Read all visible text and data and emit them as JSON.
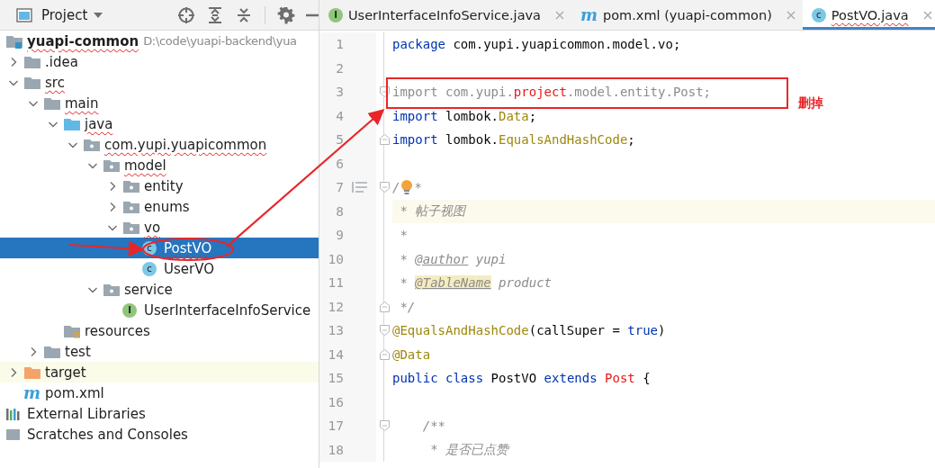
{
  "project_panel": {
    "title": "Project"
  },
  "tree": [
    {
      "label": "yuapi-common",
      "path": "D:\\code\\yuapi-backend\\yua",
      "kind": "module",
      "misspelled": true,
      "selected": false,
      "children": [
        {
          "label": ".idea",
          "kind": "folder",
          "expanded": false,
          "selected": false
        },
        {
          "label": "src",
          "kind": "folder",
          "expanded": true,
          "misspelled": true,
          "selected": false,
          "children": [
            {
              "label": "main",
              "kind": "folder",
              "expanded": true,
              "misspelled": true,
              "selected": false,
              "children": [
                {
                  "label": "java",
                  "kind": "source",
                  "expanded": true,
                  "misspelled": true,
                  "selected": false,
                  "children": [
                    {
                      "label": "com.yupi.yuapicommon",
                      "kind": "package",
                      "expanded": true,
                      "misspelled": true,
                      "selected": false,
                      "children": [
                        {
                          "label": "model",
                          "kind": "package",
                          "expanded": true,
                          "misspelled": true,
                          "selected": false,
                          "children": [
                            {
                              "label": "entity",
                              "kind": "package",
                              "expanded": false,
                              "selected": false
                            },
                            {
                              "label": "enums",
                              "kind": "package",
                              "expanded": false,
                              "selected": false
                            },
                            {
                              "label": "vo",
                              "kind": "package",
                              "expanded": true,
                              "misspelled": true,
                              "selected": false,
                              "children": [
                                {
                                  "label": "PostVO",
                                  "kind": "class",
                                  "glyph": "c",
                                  "misspelled": true,
                                  "selected": true
                                },
                                {
                                  "label": "UserVO",
                                  "kind": "class",
                                  "glyph": "c",
                                  "selected": false
                                }
                              ]
                            }
                          ]
                        },
                        {
                          "label": "service",
                          "kind": "package",
                          "expanded": true,
                          "selected": false,
                          "children": [
                            {
                              "label": "UserInterfaceInfoService",
                              "kind": "interface",
                              "glyph": "I",
                              "selected": false
                            }
                          ]
                        }
                      ]
                    }
                  ]
                },
                {
                  "label": "resources",
                  "kind": "resources",
                  "selected": false
                }
              ]
            },
            {
              "label": "test",
              "kind": "folder",
              "expanded": false,
              "selected": false
            }
          ]
        },
        {
          "label": "target",
          "kind": "excluded",
          "expanded": false,
          "highlighted": true,
          "selected": false
        },
        {
          "label": "pom.xml",
          "kind": "maven",
          "glyph": "m",
          "selected": false
        }
      ]
    },
    {
      "label": "External Libraries",
      "kind": "libraries",
      "selected": false
    },
    {
      "label": "Scratches and Consoles",
      "kind": "scratches",
      "selected": false
    }
  ],
  "tabs": [
    {
      "label": "UserInterfaceInfoService.java",
      "kind": "interface",
      "glyph": "I",
      "selected": false
    },
    {
      "label": "pom.xml (yuapi-common)",
      "kind": "maven",
      "glyph": "m",
      "selected": false
    },
    {
      "label": "PostVO.java",
      "kind": "class",
      "glyph": "c",
      "selected": true,
      "misspelled": true
    }
  ],
  "code_lines": [
    {
      "number": "1",
      "tokens": [
        {
          "kind": "keyword",
          "text": "package"
        },
        {
          "kind": "plain",
          "text": " com.yupi.yuapicommon.model.vo;"
        }
      ]
    },
    {
      "number": "2"
    },
    {
      "number": "3",
      "fold_start": true,
      "tokens": [
        {
          "kind": "unused",
          "text": "import com.yupi."
        },
        {
          "kind": "error",
          "text": "project"
        },
        {
          "kind": "unused",
          "text": ".model.entity.Post;"
        }
      ]
    },
    {
      "number": "4",
      "tokens": [
        {
          "kind": "keyword",
          "text": "import"
        },
        {
          "kind": "plain",
          "text": " lombok."
        },
        {
          "kind": "annotation",
          "text": "Data"
        },
        {
          "kind": "plain",
          "text": ";"
        }
      ]
    },
    {
      "number": "5",
      "fold_end": true,
      "tokens": [
        {
          "kind": "keyword",
          "text": "import"
        },
        {
          "kind": "plain",
          "text": " lombok."
        },
        {
          "kind": "annotation",
          "text": "EqualsAndHashCode"
        },
        {
          "kind": "plain",
          "text": ";"
        }
      ]
    },
    {
      "number": "6"
    },
    {
      "number": "7",
      "fold_start": true,
      "doc_toggle": true,
      "tokens": [
        {
          "kind": "comment",
          "text": "/"
        },
        {
          "kind": "bulb"
        },
        {
          "kind": "comment",
          "text": "*"
        }
      ]
    },
    {
      "number": "8",
      "current": true,
      "tokens": [
        {
          "kind": "comment",
          "text": " * 帖子视图"
        }
      ]
    },
    {
      "number": "9",
      "tokens": [
        {
          "kind": "comment",
          "text": " *"
        }
      ]
    },
    {
      "number": "10",
      "tokens": [
        {
          "kind": "comment",
          "text": " * "
        },
        {
          "kind": "doc-tag",
          "text": "@author"
        },
        {
          "kind": "comment",
          "text": " yupi"
        }
      ]
    },
    {
      "number": "11",
      "tokens": [
        {
          "kind": "comment",
          "text": " * "
        },
        {
          "kind": "doc-tag-marked",
          "text": "@TableName"
        },
        {
          "kind": "comment",
          "text": " product"
        }
      ]
    },
    {
      "number": "12",
      "fold_end": true,
      "tokens": [
        {
          "kind": "comment",
          "text": " */"
        }
      ]
    },
    {
      "number": "13",
      "fold_start": true,
      "tokens": [
        {
          "kind": "annotation",
          "text": "@EqualsAndHashCode"
        },
        {
          "kind": "plain",
          "text": "(callSuper = "
        },
        {
          "kind": "keyword",
          "text": "true"
        },
        {
          "kind": "plain",
          "text": ")"
        }
      ]
    },
    {
      "number": "14",
      "fold_end": true,
      "tokens": [
        {
          "kind": "annotation",
          "text": "@Data"
        }
      ]
    },
    {
      "number": "15",
      "tokens": [
        {
          "kind": "keyword",
          "text": "public class"
        },
        {
          "kind": "plain",
          "text": " PostVO "
        },
        {
          "kind": "keyword",
          "text": "extends "
        },
        {
          "kind": "error",
          "text": "Post"
        },
        {
          "kind": "plain",
          "text": " {"
        }
      ]
    },
    {
      "number": "16"
    },
    {
      "number": "17",
      "fold_start": true,
      "tokens": [
        {
          "kind": "comment",
          "text": "    /**"
        }
      ]
    },
    {
      "number": "18",
      "tokens": [
        {
          "kind": "comment",
          "text": "     * 是否已点赞"
        }
      ]
    }
  ],
  "annotation": {
    "note": "删掉"
  }
}
